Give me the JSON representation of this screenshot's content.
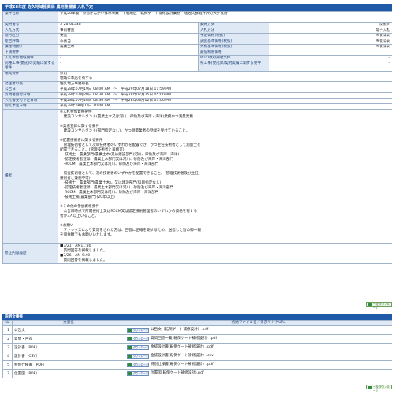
{
  "header": {
    "title": "平成28年度 佐久地域振興局 農地整備課 入札予定"
  },
  "info_rows": [
    {
      "label": "案件名称",
      "value": "平成28年度　県営かんがい排水事業　下塩地区　転倒ゲート補修設計業務　北佐久郡軽井沢町大字長倉"
    },
    {
      "label": "契約番号",
      "value": "3-28-01348",
      "label2": "契約方式",
      "value2": "一般競争"
    },
    {
      "label": "入札方式",
      "value": "事前審査",
      "label2": "入札方法",
      "value2": "電子入札"
    },
    {
      "label": "施行区分",
      "value": "委託",
      "label2": "予定価格(税抜)",
      "value2": "事後公表"
    },
    {
      "label": "総合評価",
      "value": "非該当",
      "label2": "調査基準価格(税抜)",
      "value2": "事後公表"
    },
    {
      "label": "業種(種別)",
      "value": "農業土木",
      "label2": "失格基準価格(税抜)",
      "value2": "事後公表"
    },
    {
      "label": "下請要件",
      "value": "",
      "label2": "最低制限価格",
      "value2": ""
    },
    {
      "label": "入札参加地域要件",
      "value": "-",
      "label2": "WTO政府調達案件",
      "value2": "-"
    },
    {
      "label": "同種工事(委託)の実績に関する要件",
      "value": "-",
      "label2": "県工事(委託)の契約実績に関する要件",
      "value2": "-"
    },
    {
      "label": "地域要件",
      "value": "県内\n地域に本店を有する"
    },
    {
      "label": "発注者の長",
      "value": "佐久地方事務所長"
    },
    {
      "label": "公告日",
      "value": "平成28年07月19日 08:00 AM　〜　平成29年07月18日 11:59 PM"
    },
    {
      "label": "質問書受付日時",
      "value": "平成28年07月20日 08:30 AM　〜　平成28年07月25日 05:00 PM"
    },
    {
      "label": "入札書受付予定日時",
      "value": "平成28年07月28日 08:30 AM　〜　平成28年08月02日 01:00 PM"
    },
    {
      "label": "開札予定日時",
      "value": "平成28年08月03日 10:00 AM"
    }
  ],
  "remarks": {
    "label": "備考",
    "lines": [
      "※入札参加資格要件",
      "　建設コンサルタント(農業土木又は河川、砂防及び海岸・海洋)業務かつ測量業務",
      "",
      "※業者登録に関する要件",
      "　建設コンサルタント(部門指定なし)、かつ測量業者の登録を受けていること。",
      "",
      "※配置技術者に関する要件",
      "　管理技術者として次の技術者のいずれかを配置でき、かつ主任技術者として測量士を",
      "配置できること。(管理技術者と兼務可)",
      "　-技術士　農業部門(農業土木)又は建設部門(河川、砂防及び海岸・海洋)",
      "　-認定技術者登録　農業土木部門又は河川、砂防及び海岸・海洋部門",
      "　-RCCM　農業土木部門又は河川、砂防及び海岸・海洋部門",
      "",
      "　照査技術者として、次の技術者のいずれかを配置できること。(管理技術者及び主任",
      "技術者と兼務不可)",
      "　-技術士　農業部門(農業土木)、又は建設部門(科目指定なし)",
      "　-認定技術者登録　農業土木部門又は河川、砂防及び海岸・海洋部門",
      "　-RCCM　農業土木部門又は河川、砂防及び海岸・海洋部門",
      "　-技術士補(農業部門)(20年以上)",
      "",
      "※その他の参加資格要件",
      "　公告日時点で所属技術士又はRCCM又は認定技術管理者のいずれかの資格を有する",
      "者が3人以上いること。",
      "",
      "※お願い",
      "　ファックスにより質問をされた方は、回答に正確を期するため、送信した旨の御一報",
      "を御依頼でもお願いいたします。"
    ]
  },
  "corrections": {
    "label": "修正内容履歴",
    "lines": [
      "■7/21　AM11:30",
      "　質問回答を掲載しました。",
      "■7/26　AM 9:40",
      "　質問回答を掲載しました。"
    ]
  },
  "download_all_label": "一括ダウンロード",
  "documents": {
    "section_title": "説明文書等",
    "col_no": "No",
    "col_name": "文書名",
    "col_file": "格納ファイル名／外部リンクURL",
    "download_label": "ダウンロード",
    "rows": [
      {
        "no": "1",
        "name": "公告文",
        "file": "公告文（転倒ゲート補修設計）.pdf"
      },
      {
        "no": "2",
        "name": "質問・回答",
        "file": "質問回答一覧(転倒ゲート補修設計）.pdf"
      },
      {
        "no": "3",
        "name": "設計書（PDF）",
        "file": "金抜設計書(転倒ゲート補修設計）.pdf"
      },
      {
        "no": "4",
        "name": "設計書（CSV）",
        "file": "金抜設計書(転倒ゲート補修設計）.csv"
      },
      {
        "no": "5",
        "name": "特別仕様書（PDF）",
        "file": "特別仕様書(転倒ゲート補修設計）.pdf"
      },
      {
        "no": "7",
        "name": "位置図（PDF）",
        "file": "位置図(転倒ゲート補修設計).pdf"
      }
    ]
  }
}
